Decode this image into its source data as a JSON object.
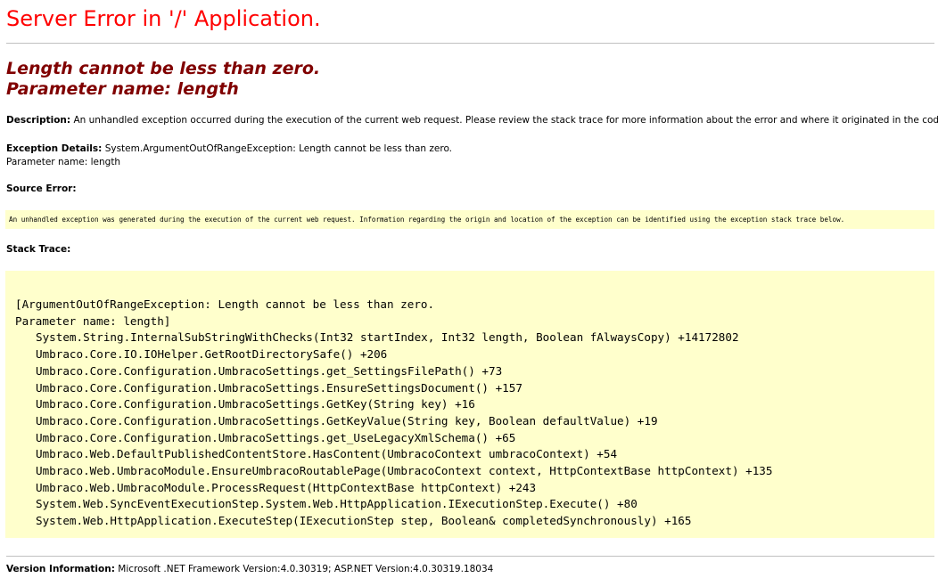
{
  "page": {
    "title": "Server Error in '/' Application.",
    "message_line1": "Length cannot be less than zero.",
    "message_line2": "Parameter name: length"
  },
  "description": {
    "label": "Description:",
    "text": "An unhandled exception occurred during the execution of the current web request. Please review the stack trace for more information about the error and where it originated in the code."
  },
  "exception_details": {
    "label": "Exception Details:",
    "text": "System.ArgumentOutOfRangeException: Length cannot be less than zero.",
    "text2": "Parameter name: length"
  },
  "source_error": {
    "label": "Source Error:",
    "text": "An unhandled exception was generated during the execution of the current web request. Information regarding the origin and location of the exception can be identified using the exception stack trace below."
  },
  "stack_trace": {
    "label": "Stack Trace:",
    "header_line1": "[ArgumentOutOfRangeException: Length cannot be less than zero.",
    "header_line2": "Parameter name: length]",
    "frames": [
      "System.String.InternalSubStringWithChecks(Int32 startIndex, Int32 length, Boolean fAlwaysCopy) +14172802",
      "Umbraco.Core.IO.IOHelper.GetRootDirectorySafe() +206",
      "Umbraco.Core.Configuration.UmbracoSettings.get_SettingsFilePath() +73",
      "Umbraco.Core.Configuration.UmbracoSettings.EnsureSettingsDocument() +157",
      "Umbraco.Core.Configuration.UmbracoSettings.GetKey(String key) +16",
      "Umbraco.Core.Configuration.UmbracoSettings.GetKeyValue(String key, Boolean defaultValue) +19",
      "Umbraco.Core.Configuration.UmbracoSettings.get_UseLegacyXmlSchema() +65",
      "Umbraco.Web.DefaultPublishedContentStore.HasContent(UmbracoContext umbracoContext) +54",
      "Umbraco.Web.UmbracoModule.EnsureUmbracoRoutablePage(UmbracoContext context, HttpContextBase httpContext) +135",
      "Umbraco.Web.UmbracoModule.ProcessRequest(HttpContextBase httpContext) +243",
      "System.Web.SyncEventExecutionStep.System.Web.HttpApplication.IExecutionStep.Execute() +80",
      "System.Web.HttpApplication.ExecuteStep(IExecutionStep step, Boolean& completedSynchronously) +165"
    ]
  },
  "version_info": {
    "label": "Version Information:",
    "text": "Microsoft .NET Framework Version:4.0.30319; ASP.NET Version:4.0.30319.18034"
  },
  "colors": {
    "title": "#ff0000",
    "message": "#800000",
    "code_background": "#ffffcc",
    "rule": "#c0c0c0"
  }
}
